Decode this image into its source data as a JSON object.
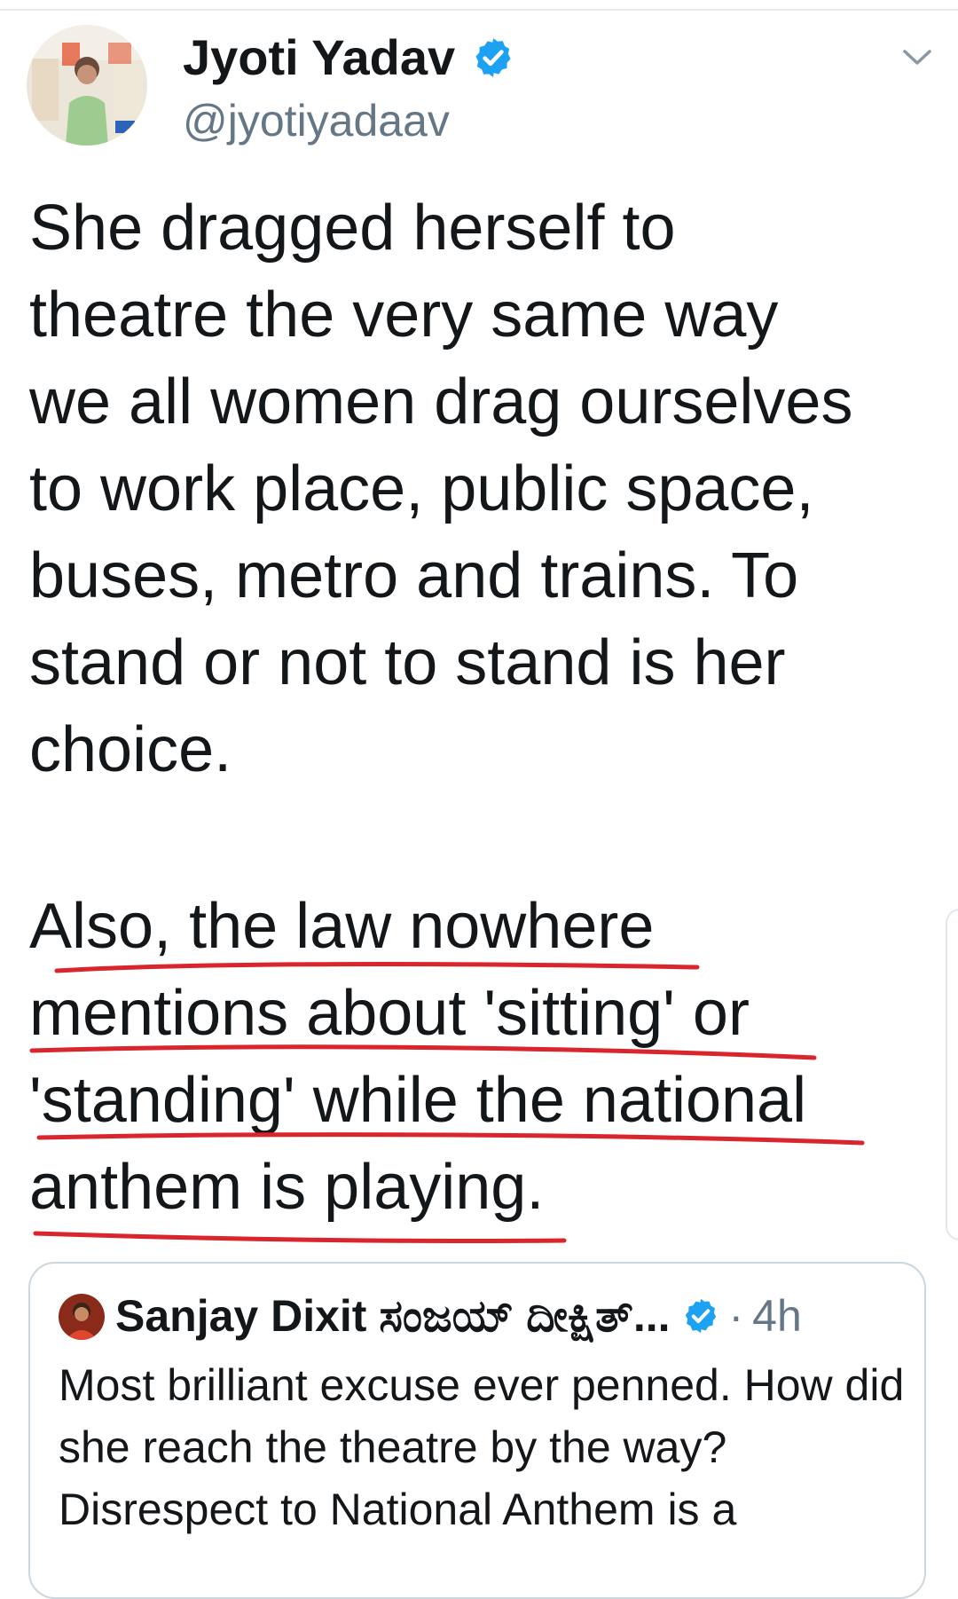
{
  "tweet": {
    "author": {
      "name": "Jyoti Yadav",
      "handle": "@jyotiyadaav",
      "verified": true,
      "avatar_icon": "profile-photo"
    },
    "text_paragraph_1": "She dragged herself to\ntheatre the very same way\nwe all women drag ourselves\nto work place, public space,\nbuses, metro and trains. To\nstand or not to stand is her\nchoice.",
    "text_paragraph_2_lines": [
      "Also, the law nowhere",
      "mentions about 'sitting' or",
      "'standing' while the national",
      "anthem is playing."
    ]
  },
  "quoted_tweet": {
    "author_name": "Sanjay Dixit ಸಂಜಯ್ ದೀಕ್ಷಿತ್...",
    "separator": "·",
    "time": "4h",
    "verified": true,
    "text": "Most brilliant excuse ever penned. How did she reach the theatre by the way? Disrespect to National Anthem is a"
  },
  "colors": {
    "text": "#14171a",
    "secondary": "#657786",
    "verified_blue": "#1da1f2",
    "ink_underline": "#d9262d",
    "border": "#ccd6dd"
  }
}
